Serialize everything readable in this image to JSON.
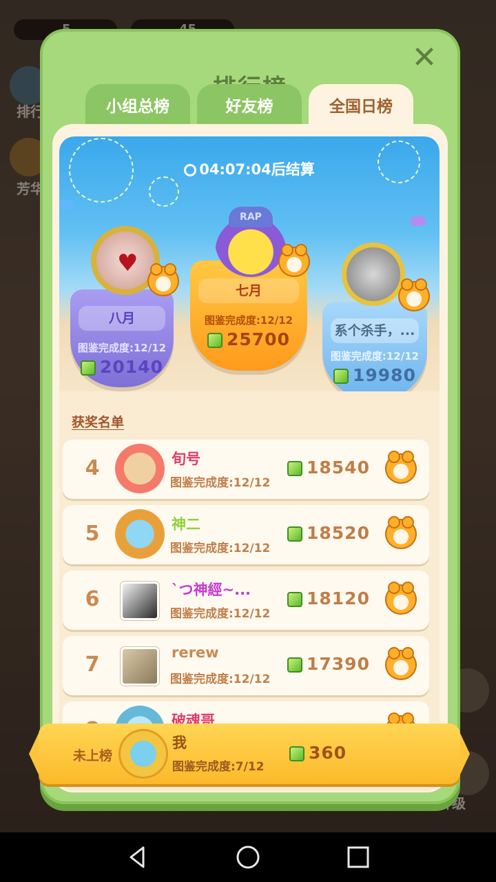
{
  "background": {
    "top_counters": [
      "5",
      "45"
    ],
    "side_labels": [
      "排行",
      "芳华"
    ],
    "right_label": "升级"
  },
  "modal": {
    "title": "排行榜",
    "close_icon": "close-icon",
    "tabs": [
      {
        "label": "小组总榜",
        "active": false
      },
      {
        "label": "好友榜",
        "active": false
      },
      {
        "label": "全国日榜",
        "active": true
      }
    ]
  },
  "banner": {
    "timer_text": "04:07:04后结算",
    "clock_icon": "clock-icon",
    "podium": [
      {
        "place": 2,
        "name": "八月",
        "progress": "图鉴完成度:12/12",
        "score": "20140"
      },
      {
        "place": 1,
        "name": "七月",
        "progress": "图鉴完成度:12/12",
        "score": "25700",
        "hat_text": "RAP"
      },
      {
        "place": 3,
        "name": "系个杀手，...",
        "progress": "图鉴完成度:12/12",
        "score": "19980"
      }
    ]
  },
  "section_label": "获奖名单",
  "rows": [
    {
      "rank": "4",
      "name": "旬号",
      "name_color": "#e23a6a",
      "progress": "图鉴完成度:12/12",
      "score": "18540"
    },
    {
      "rank": "5",
      "name": "神二",
      "name_color": "#8fd23a",
      "progress": "图鉴完成度:12/12",
      "score": "18520"
    },
    {
      "rank": "6",
      "name": "`つ神經~...",
      "name_color": "#c43ad0",
      "progress": "图鉴完成度:12/12",
      "score": "18120"
    },
    {
      "rank": "7",
      "name": "rerew",
      "name_color": "#c98a52",
      "progress": "图鉴完成度:12/12",
      "score": "17390"
    },
    {
      "rank": "8",
      "name": "破魂哥",
      "name_color": "#e23a6a",
      "progress": "",
      "score": ""
    }
  ],
  "my_bar": {
    "status": "未上榜",
    "name": "我",
    "progress": "图鉴完成度:7/12",
    "score": "360"
  },
  "colors": {
    "modal_green": "#a6d97b",
    "active_tab": "#fdf3e0",
    "gold_podium": "#ffb02b",
    "my_bar": "#fbc43a"
  }
}
